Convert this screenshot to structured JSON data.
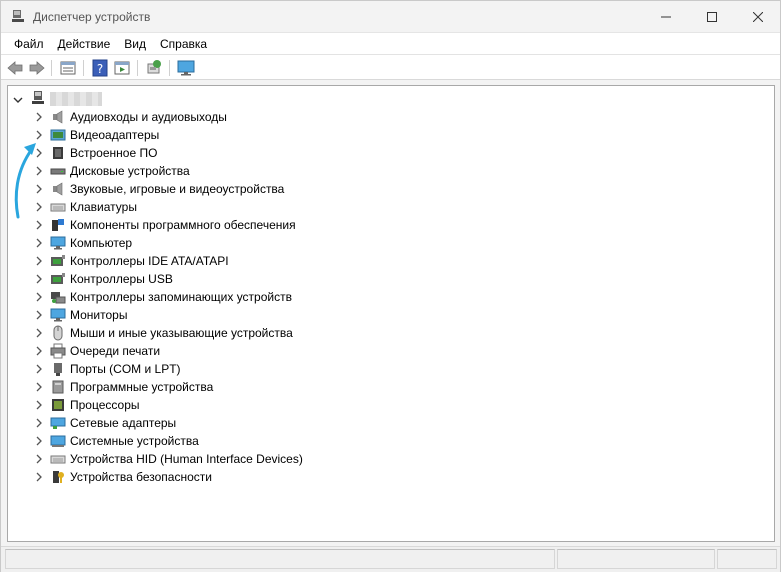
{
  "window": {
    "title": "Диспетчер устройств"
  },
  "menu": {
    "items": [
      {
        "label": "Файл"
      },
      {
        "label": "Действие"
      },
      {
        "label": "Вид"
      },
      {
        "label": "Справка"
      }
    ]
  },
  "toolbar": {
    "icons": [
      "back-icon",
      "forward-icon",
      "properties-icon",
      "help-icon",
      "scan-hardware-icon",
      "update-driver-icon",
      "monitor-icon"
    ]
  },
  "tree": {
    "root": {
      "expanded": true,
      "name_obscured": true
    },
    "categories": [
      {
        "label": "Аудиовходы и аудиовыходы",
        "icon": "speaker-icon"
      },
      {
        "label": "Видеоадаптеры",
        "icon": "display-adapter-icon"
      },
      {
        "label": "Встроенное ПО",
        "icon": "firmware-icon"
      },
      {
        "label": "Дисковые устройства",
        "icon": "disk-drive-icon"
      },
      {
        "label": "Звуковые, игровые и видеоустройства",
        "icon": "sound-icon"
      },
      {
        "label": "Клавиатуры",
        "icon": "keyboard-icon"
      },
      {
        "label": "Компоненты программного обеспечения",
        "icon": "software-component-icon"
      },
      {
        "label": "Компьютер",
        "icon": "computer-icon"
      },
      {
        "label": "Контроллеры IDE ATA/ATAPI",
        "icon": "ide-controller-icon"
      },
      {
        "label": "Контроллеры USB",
        "icon": "usb-controller-icon"
      },
      {
        "label": "Контроллеры запоминающих устройств",
        "icon": "storage-controller-icon"
      },
      {
        "label": "Мониторы",
        "icon": "monitor-icon"
      },
      {
        "label": "Мыши и иные указывающие устройства",
        "icon": "mouse-icon"
      },
      {
        "label": "Очереди печати",
        "icon": "printer-icon"
      },
      {
        "label": "Порты (COM и LPT)",
        "icon": "port-icon"
      },
      {
        "label": "Программные устройства",
        "icon": "software-device-icon"
      },
      {
        "label": "Процессоры",
        "icon": "processor-icon"
      },
      {
        "label": "Сетевые адаптеры",
        "icon": "network-adapter-icon"
      },
      {
        "label": "Системные устройства",
        "icon": "system-device-icon"
      },
      {
        "label": "Устройства HID (Human Interface Devices)",
        "icon": "hid-icon"
      },
      {
        "label": "Устройства безопасности",
        "icon": "security-device-icon"
      }
    ]
  },
  "colors": {
    "annotation_arrow": "#2aa6de",
    "window_bg": "#f3f3f3",
    "tree_bg": "#ffffff"
  }
}
